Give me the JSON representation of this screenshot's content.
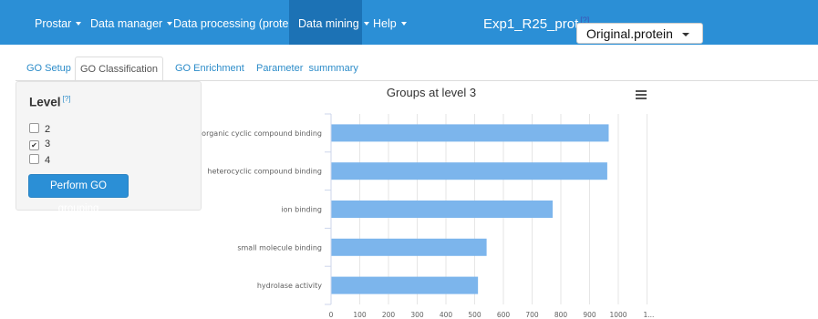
{
  "navbar": {
    "items": [
      {
        "label": "Prostar",
        "dropdown": true
      },
      {
        "label": "Data manager",
        "dropdown": true
      },
      {
        "label": "Data processing (protein)",
        "dropdown": true
      },
      {
        "label": "Data mining",
        "dropdown": true,
        "active": true
      },
      {
        "label": "Help",
        "dropdown": true
      }
    ],
    "app_title": "Exp1_R25_prot",
    "help_marker": "[?]",
    "dataset_select": {
      "value": "Original.protein"
    }
  },
  "tabs": [
    {
      "label": "GO Setup"
    },
    {
      "label": "GO Classification",
      "active": true
    },
    {
      "label": "GO Enrichment"
    },
    {
      "label": "Parameter  summmary"
    }
  ],
  "sidebar": {
    "title": "Level",
    "help_marker": "[?]",
    "options": [
      {
        "label": "2",
        "checked": false
      },
      {
        "label": "3",
        "checked": true
      },
      {
        "label": "4",
        "checked": false
      }
    ],
    "button_label": "Perform GO grouping"
  },
  "chart_data": {
    "type": "bar",
    "orientation": "horizontal",
    "title": "Groups at level 3",
    "categories": [
      "organic cyclic compound binding",
      "heterocyclic compound binding",
      "ion binding",
      "small molecule binding",
      "hydrolase activity"
    ],
    "values": [
      965,
      960,
      770,
      540,
      510
    ],
    "xlim": [
      0,
      1100
    ],
    "xticks": [
      "0",
      "100",
      "200",
      "300",
      "400",
      "500",
      "600",
      "700",
      "800",
      "900",
      "1000",
      "1..."
    ],
    "grid": true,
    "bar_color": "#7cb5ec"
  },
  "colors": {
    "navbar": "#2b8fd6",
    "navbar_active": "#1c72b5",
    "link": "#2c8cc9",
    "bar": "#7cb5ec"
  },
  "icons": {
    "chart_menu": "hamburger-menu-icon"
  }
}
